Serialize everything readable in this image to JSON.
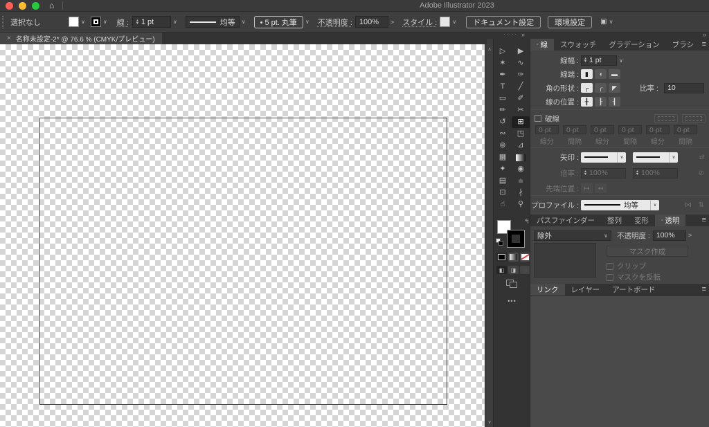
{
  "titlebar": {
    "title": "Adobe Illustrator 2023",
    "home_icon": "⌂"
  },
  "icons": {
    "chevron": "∨",
    "stepper_up": "▴",
    "stepper_down": "▾",
    "menu": "≡",
    "collapse": "»",
    "close": "×",
    "swap_h": "⇄",
    "swap_corner": "↰",
    "link_broken": "⊘",
    "flip_x": "⋈",
    "flip_y": "⇅",
    "tip_in": "↦",
    "tip_out": "↤",
    "more": "•••",
    "grip_dots": "·····",
    "scroll_up": "∧",
    "scroll_down": "∨",
    "arrange": "▣",
    "active_dot": "◦",
    "gt": ">"
  },
  "controlbar": {
    "selection_status": "選択なし",
    "stroke_label": "線 :",
    "stroke_weight": "1 pt",
    "width_profile_label": "均等",
    "brush_label": "•  5 pt. 丸筆",
    "opacity_label": "不透明度 :",
    "opacity_value": "100%",
    "style_label": "スタイル :",
    "document_setup": "ドキュメント設定",
    "preferences": "環境設定"
  },
  "tabbar": {
    "title": "名称未設定-2* @ 76.6 % (CMYK/プレビュー)"
  },
  "tools": [
    {
      "name": "selection",
      "glyph": "▷"
    },
    {
      "name": "direct-selection",
      "glyph": "▶"
    },
    {
      "name": "magic-wand",
      "glyph": "✶"
    },
    {
      "name": "lasso",
      "glyph": "∿"
    },
    {
      "name": "pen",
      "glyph": "✒"
    },
    {
      "name": "curvature",
      "glyph": "✑"
    },
    {
      "name": "type",
      "glyph": "T"
    },
    {
      "name": "line-segment",
      "glyph": "╱"
    },
    {
      "name": "rectangle",
      "glyph": "▭"
    },
    {
      "name": "paintbrush",
      "glyph": "✐"
    },
    {
      "name": "pencil",
      "glyph": "✏"
    },
    {
      "name": "scissors",
      "glyph": "✂"
    },
    {
      "name": "rotate",
      "glyph": "↺"
    },
    {
      "name": "scale",
      "glyph": "⊞",
      "selected": true
    },
    {
      "name": "width",
      "glyph": "∾"
    },
    {
      "name": "free-transform",
      "glyph": "◳"
    },
    {
      "name": "shape-builder",
      "glyph": "⊛"
    },
    {
      "name": "perspective-grid",
      "glyph": "⊿"
    },
    {
      "name": "mesh",
      "glyph": "▦"
    },
    {
      "name": "gradient",
      "glyph": ""
    },
    {
      "name": "eyedropper",
      "glyph": "✦"
    },
    {
      "name": "blend",
      "glyph": "◉"
    },
    {
      "name": "symbol-sprayer",
      "glyph": "▤"
    },
    {
      "name": "graph",
      "glyph": "ılı"
    },
    {
      "name": "artboard",
      "glyph": "⊡"
    },
    {
      "name": "slice",
      "glyph": "∤"
    },
    {
      "name": "hand",
      "glyph": "☝"
    },
    {
      "name": "zoom",
      "glyph": "⚲"
    }
  ],
  "stroke_panel": {
    "tabs": [
      "線",
      "スウォッチ",
      "グラデーション",
      "ブラシ"
    ],
    "weight_label": "線幅 :",
    "weight_value": "1 pt",
    "cap_label": "線端 :",
    "cap_icons": [
      "▮",
      "◖",
      "▬"
    ],
    "corner_label": "角の形状 :",
    "corner_icons": [
      "┌",
      "╭",
      "◤"
    ],
    "miter_label": "比率 :",
    "miter_value": "10",
    "align_label": "線の位置 :",
    "align_icons": [
      "╂",
      "┠",
      "┨"
    ],
    "dashed_label": "破線",
    "dash_fields": [
      {
        "value": "0 pt",
        "label": "線分"
      },
      {
        "value": "0 pt",
        "label": "間隔"
      },
      {
        "value": "0 pt",
        "label": "線分"
      },
      {
        "value": "0 pt",
        "label": "間隔"
      },
      {
        "value": "0 pt",
        "label": "線分"
      },
      {
        "value": "0 pt",
        "label": "間隔"
      }
    ],
    "arrow_label": "矢印 :",
    "scale_label": "倍率 :",
    "scale_value_1": "100%",
    "scale_value_2": "100%",
    "tip_label": "先端位置 :",
    "profile_label": "プロファイル :",
    "profile_value": "均等"
  },
  "transparency_panel": {
    "tabs": [
      "パスファインダー",
      "整列",
      "変形",
      "透明"
    ],
    "blend_mode": "除外",
    "opacity_label": "不透明度 :",
    "opacity_value": "100%",
    "make_mask": "マスク作成",
    "clip_label": "クリップ",
    "invert_label": "マスクを反転"
  },
  "links_panel": {
    "tabs": [
      "リンク",
      "レイヤー",
      "アートボード"
    ]
  }
}
